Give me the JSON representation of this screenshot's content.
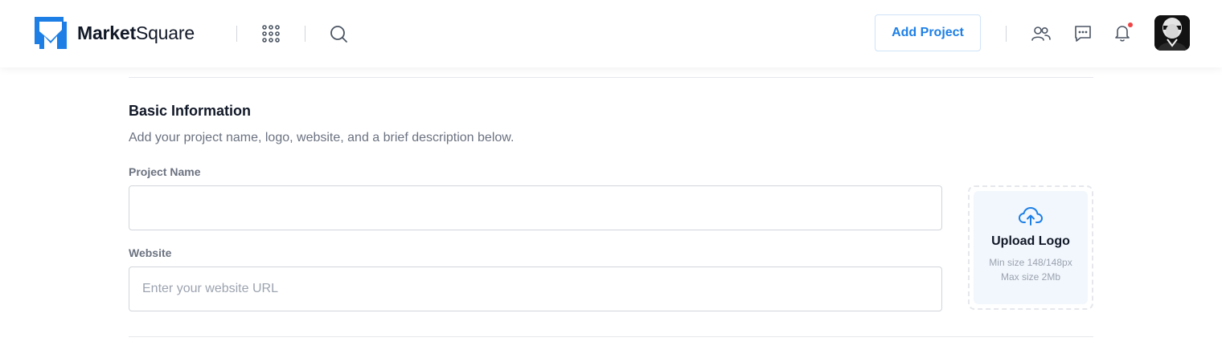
{
  "header": {
    "brand": {
      "name_bold": "Market",
      "name_regular": "Square",
      "logo_color": "#1d7fe6"
    },
    "icons": {
      "apps": "grid-dots-icon",
      "search": "search-icon",
      "team": "users-icon",
      "messages": "chat-icon",
      "notifications": "bell-icon"
    },
    "add_project_label": "Add Project",
    "notification_dot_color": "#ef4444",
    "avatar": "user-avatar"
  },
  "form": {
    "section_title": "Basic Information",
    "section_description": "Add your project name, logo, website, and a brief description below.",
    "project_name": {
      "label": "Project Name",
      "value": "",
      "placeholder": ""
    },
    "website": {
      "label": "Website",
      "value": "",
      "placeholder": "Enter your website URL"
    },
    "upload": {
      "title": "Upload Logo",
      "hint_min": "Min size 148/148px",
      "hint_max": "Max size 2Mb",
      "icon": "cloud-upload-icon"
    }
  },
  "colors": {
    "accent": "#1d7fe6",
    "muted_text": "#6b7280",
    "border": "#d1d5db"
  }
}
